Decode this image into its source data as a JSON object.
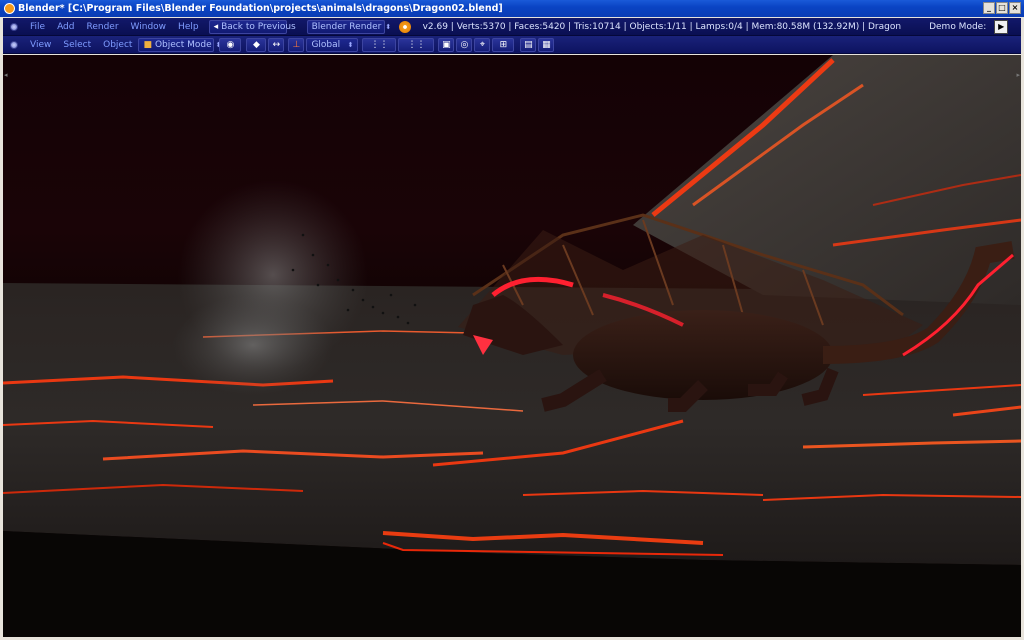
{
  "window": {
    "title": "Blender* [C:\\Program Files\\Blender Foundation\\projects\\animals\\dragons\\Dragon02.blend]",
    "controls": [
      "_",
      "□",
      "×"
    ]
  },
  "top_header": {
    "menus": [
      "File",
      "Add",
      "Render",
      "Window",
      "Help"
    ],
    "back_button": "Back to Previous",
    "render_engine": "Blender Render",
    "stats": "v2.69 | Verts:5370 | Faces:5420 | Tris:10714 | Objects:1/11 | Lamps:0/4 | Mem:80.58M (132.92M) | Dragon",
    "demo_mode_label": "Demo Mode:"
  },
  "view_header": {
    "menus": [
      "View",
      "Select",
      "Object"
    ],
    "mode": "Object Mode",
    "orientation": "Global"
  },
  "colors": {
    "header_bg": "#0a0f52",
    "menu_text": "#7f9cff",
    "title_bar": "#0a44c4",
    "lava": "#ff3a10"
  }
}
